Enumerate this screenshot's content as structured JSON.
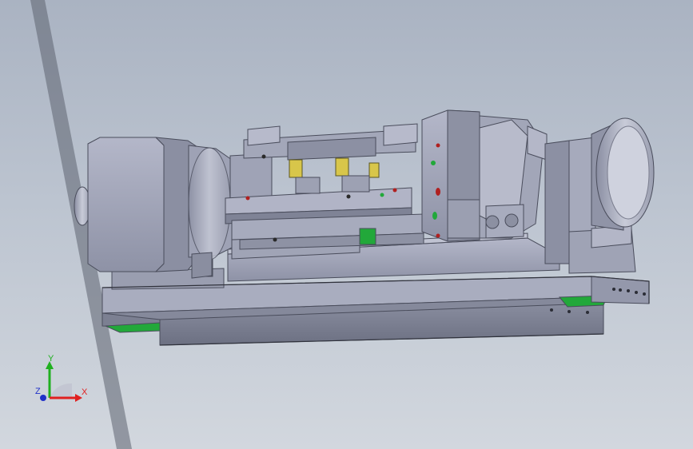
{
  "viewport": {
    "background_top": "#aab3c2",
    "background_bottom": "#d2d7de",
    "model": {
      "name": "",
      "body_color": "#9fa3b8",
      "dark_edge_color": "#5a5d6d",
      "accent_colors": [
        "#d8c64a",
        "#22a83a",
        "#b02020"
      ]
    }
  },
  "triad": {
    "x_label": "X",
    "y_label": "Y",
    "z_label": "Z",
    "x_color": "#e02020",
    "y_color": "#20b020",
    "z_color": "#2030c8"
  }
}
